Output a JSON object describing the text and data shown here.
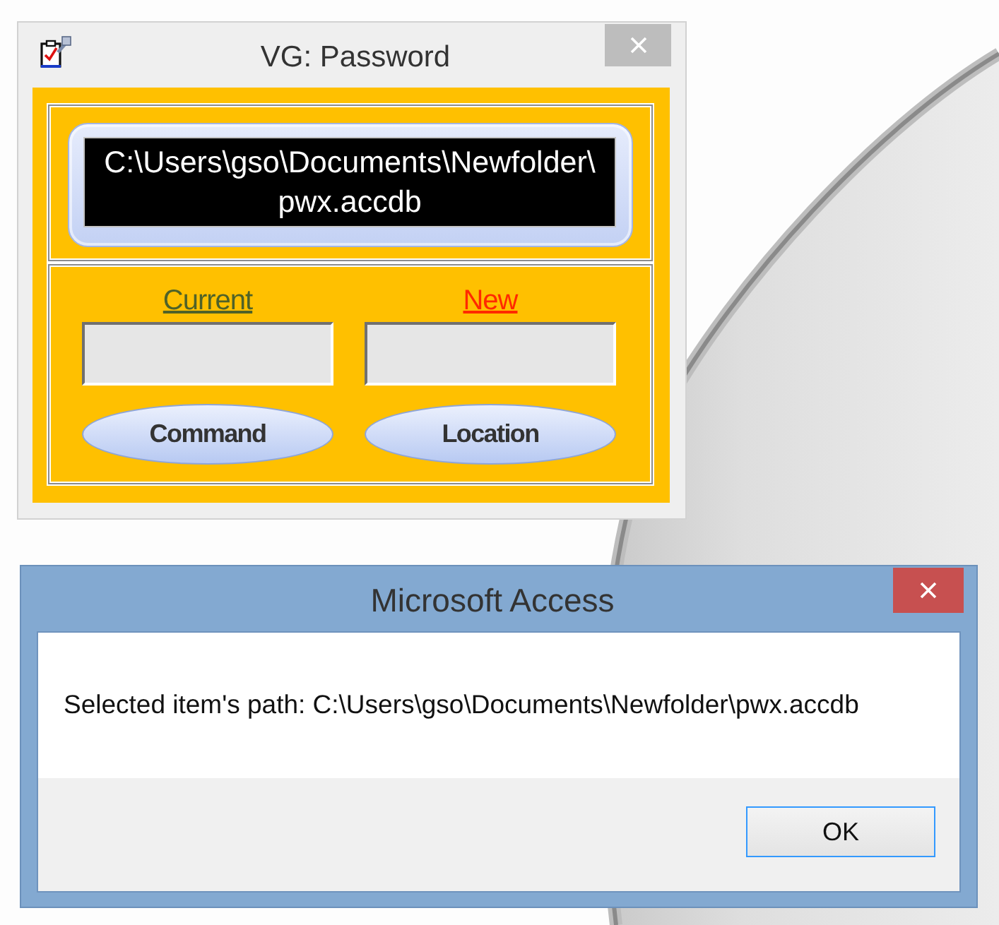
{
  "password_window": {
    "title": "VG: Password",
    "path_display": "C:\\Users\\gso\\Documents\\Newfolder\\pwx.accdb",
    "fields": [
      {
        "label": "Current",
        "color": "#4f6228"
      },
      {
        "label": "New",
        "color": "#ff2a00"
      }
    ],
    "buttons": [
      "Command",
      "Location"
    ]
  },
  "message_dialog": {
    "title": "Microsoft Access",
    "message": "Selected item's path: C:\\Users\\gso\\Documents\\Newfolder\\pwx.accdb",
    "buttons": [
      {
        "label": "OK",
        "focused": true
      }
    ]
  }
}
